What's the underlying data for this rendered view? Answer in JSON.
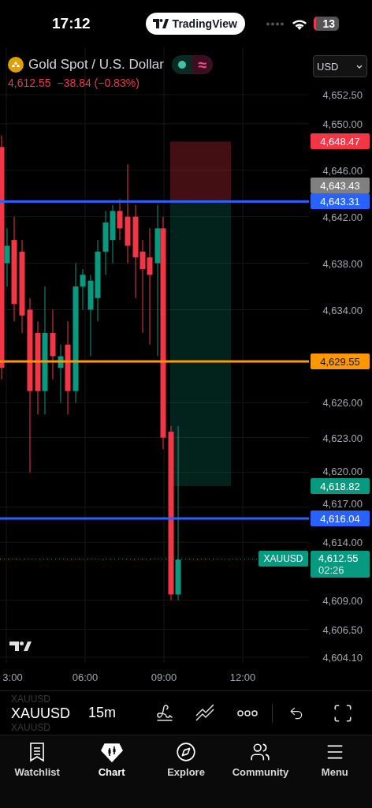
{
  "status_bar": {
    "time": "17:12",
    "app_badge": "TradingView",
    "battery": "13"
  },
  "header": {
    "title": "Gold Spot / U.S. Dollar",
    "toggle_symbol": "≈",
    "price": "4,612.55",
    "change": "−38.84 (−0.83%)",
    "currency": "USD"
  },
  "price_axis": {
    "ticks": [
      "4,652.50",
      "4,650.00",
      "4,646.00",
      "4,642.00",
      "4,638.00",
      "4,634.00",
      "4,626.00",
      "4,623.00",
      "4,620.00",
      "4,617.00",
      "4,614.00",
      "4,609.00",
      "4,606.50",
      "4,604.10"
    ]
  },
  "price_markers": [
    {
      "label": "4,648.47",
      "color": "#f23645",
      "line": false
    },
    {
      "label": "4,643.43",
      "color": "#808080",
      "line": false
    },
    {
      "label": "4,643.31",
      "color": "#2962ff",
      "line": true
    },
    {
      "label": "4,629.55",
      "color": "#ff9800",
      "line": true
    },
    {
      "label": "4,618.82",
      "color": "#089981",
      "line": false
    },
    {
      "label": "4,616.04",
      "color": "#2962ff",
      "line": true
    }
  ],
  "last_price": {
    "symbol": "XAUUSD",
    "price": "4,612.55",
    "countdown": "02:26",
    "color": "#089981"
  },
  "time_axis": {
    "ticks": [
      "3:00",
      "06:00",
      "09:00",
      "12:00"
    ]
  },
  "toolbar": {
    "symbols": [
      {
        "label": "XAUUSD",
        "selected": false
      },
      {
        "label": "XAUUSD",
        "selected": true
      },
      {
        "label": "XAUUSD",
        "selected": false
      }
    ],
    "interval": "15m"
  },
  "tab_bar": [
    {
      "label": "Watchlist",
      "selected": false
    },
    {
      "label": "Chart",
      "selected": true
    },
    {
      "label": "Explore",
      "selected": false
    },
    {
      "label": "Community",
      "selected": false
    },
    {
      "label": "Menu",
      "selected": false
    }
  ]
}
